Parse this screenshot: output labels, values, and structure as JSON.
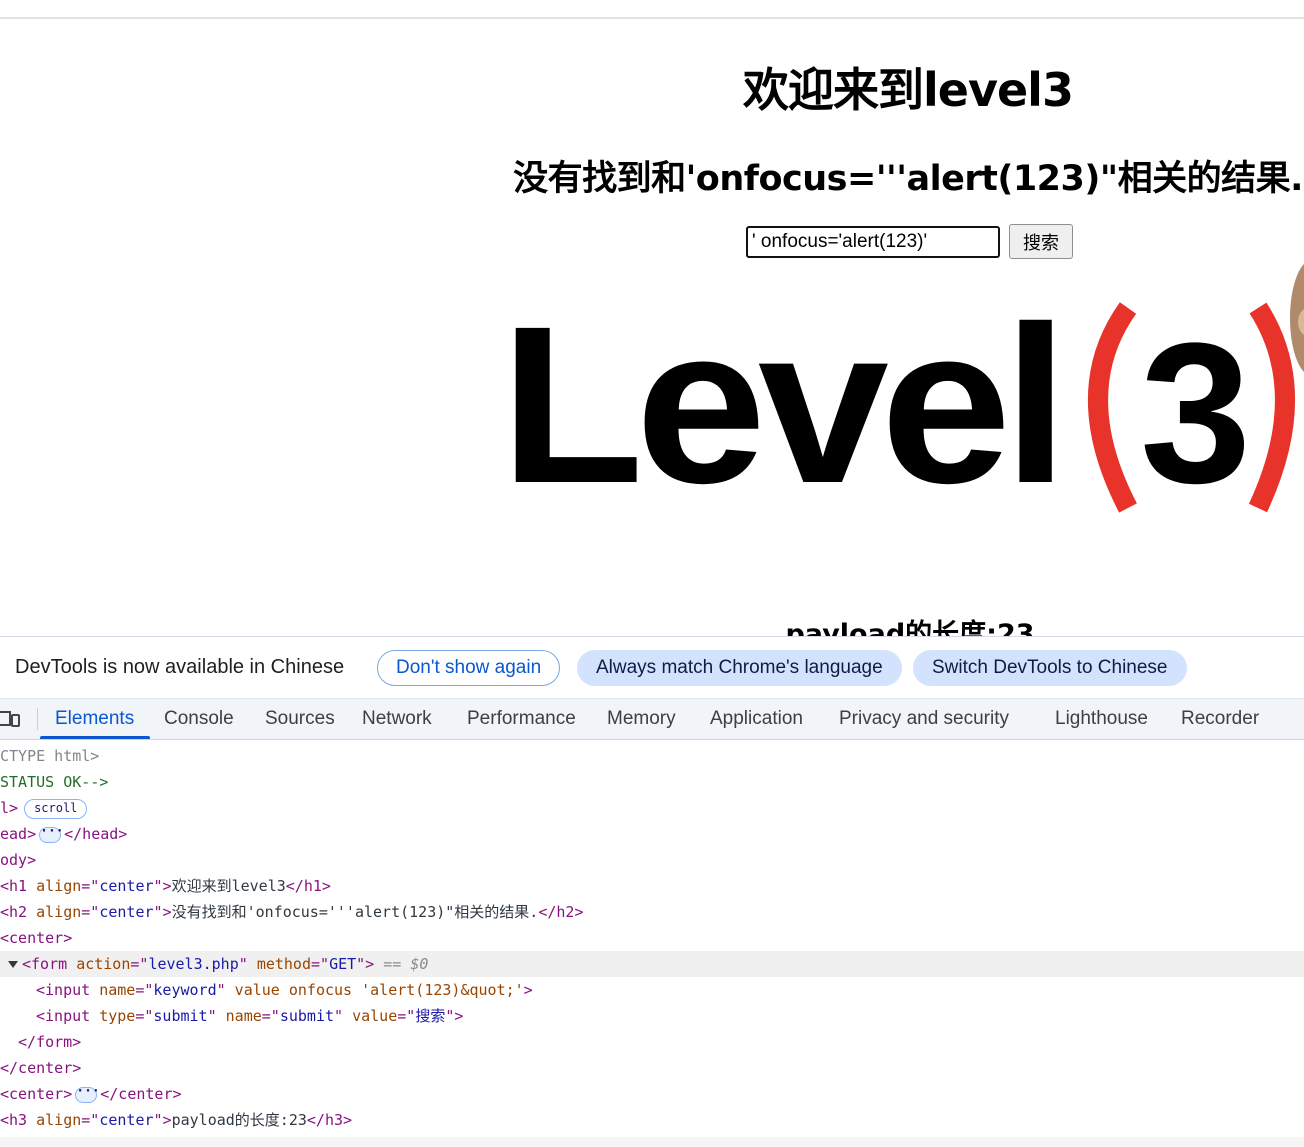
{
  "page": {
    "h1": "欢迎来到level3",
    "h2": "没有找到和'onfocus='''alert(123)\"相关的结果.",
    "search_input_value": "' onfocus='alert(123)'",
    "search_button_label": "搜索",
    "logo_text": "Level",
    "logo_number": "3",
    "h3": "payload的长度:23"
  },
  "devtools": {
    "infobar": {
      "message": "DevTools is now available in Chinese",
      "dont_show": "Don't show again",
      "always_match": "Always match Chrome's language",
      "switch": "Switch DevTools to Chinese"
    },
    "tabs": [
      "Elements",
      "Console",
      "Sources",
      "Network",
      "Performance",
      "Memory",
      "Application",
      "Privacy and security",
      "Lighthouse",
      "Recorder"
    ],
    "dom": {
      "l0": "CTYPE html>",
      "l1": "STATUS OK-->",
      "l2_tag": "l>",
      "l2_badge": "scroll",
      "l3_open": "ead>",
      "l3_close": "</head>",
      "l4": "ody>",
      "l5": {
        "open": "<h1 ",
        "attr": "align",
        "eq": "=\"",
        "val": "center",
        "close": "\">",
        "text": "欢迎来到level3",
        "end": "</h1>"
      },
      "l6": {
        "open": "<h2 ",
        "attr": "align",
        "eq": "=\"",
        "val": "center",
        "close": "\">",
        "text": "没有找到和'onfocus='''alert(123)\"相关的结果.",
        "end": "</h2>"
      },
      "l7": "<center>",
      "l8": {
        "open": "<form ",
        "a1": "action",
        "v1": "level3.php",
        "a2": "method",
        "v2": "GET",
        "close": "\">",
        "ref": "== $0"
      },
      "l9": {
        "open": "<input ",
        "a1": "name",
        "v1": "keyword",
        "rest": " value onfocus 'alert(123)&quot;'",
        "close": ">"
      },
      "l10": {
        "open": "<input ",
        "a1": "type",
        "v1": "submit",
        "a2": "name",
        "v2": "submit",
        "a3": "value",
        "v3": "搜索",
        "close": "\">"
      },
      "l11": "</form>",
      "l12": "</center>",
      "l13_open": "<center>",
      "l13_close": "</center>",
      "l14": {
        "open": "<h3 ",
        "attr": "align",
        "eq": "=\"",
        "val": "center",
        "close": "\">",
        "text": "payload的长度:23",
        "end": "</h3>"
      }
    }
  },
  "colors": {
    "accent": "#0b57d0",
    "tag": "#881280",
    "attr": "#994500",
    "value": "#1a1aa6",
    "comment": "#236e25",
    "logo_paren": "#e8332a"
  }
}
